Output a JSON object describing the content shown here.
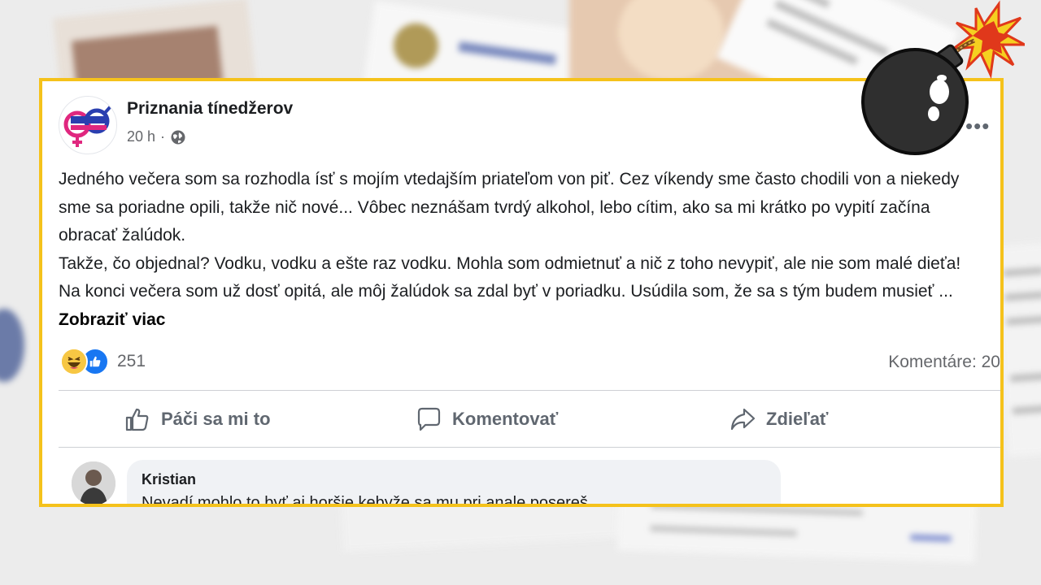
{
  "post": {
    "page_name": "Priznania tínedžerov",
    "time": "20 h",
    "separator": "·",
    "paragraph1": "Jedného večera som sa rozhodla ísť s mojím vtedajším priateľom von piť. Cez víkendy sme často chodili von a niekedy sme sa poriadne opili, takže nič nové... Vôbec neznášam tvrdý alkohol, lebo cítim, ako sa mi krátko po vypití začína obracať žalúdok.",
    "paragraph2": "Takže, čo objednal? Vodku, vodku a ešte raz vodku. Mohla som odmietnuť a nič z toho nevypiť, ale nie som malé dieťa! Na konci večera som už dosť opitá, ale môj žalúdok sa zdal byť v poriadku. Usúdila som, že sa s tým budem musieť ...",
    "see_more": "Zobraziť viac",
    "reaction_count": "251",
    "comments": "Komentáre: 20"
  },
  "actions": {
    "like": "Páči sa mi to",
    "comment": "Komentovať",
    "share": "Zdieľať"
  },
  "comment": {
    "author": "Kristian",
    "text": "Nevadí mohlo to byť aj horšie kebyže sa mu pri anale posereš"
  },
  "colors": {
    "frame": "#f5c21b",
    "like_blue": "#1877f2",
    "haha_yellow": "#f7c744"
  },
  "icons": [
    "globe-icon",
    "more-icon",
    "haha-reaction-icon",
    "like-reaction-icon",
    "thumbs-up-icon",
    "comment-icon",
    "share-icon",
    "bomb-icon"
  ]
}
